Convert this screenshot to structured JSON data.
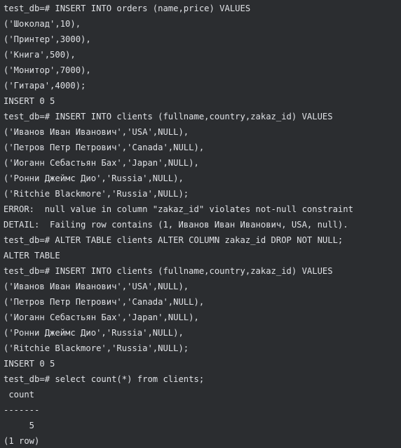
{
  "terminal": {
    "lines": [
      "test_db=# INSERT INTO orders (name,price) VALUES",
      "('Шоколад',10),",
      "('Принтер',3000),",
      "('Книга',500),",
      "('Монитор',7000),",
      "('Гитара',4000);",
      "INSERT 0 5",
      "test_db=# INSERT INTO clients (fullname,country,zakaz_id) VALUES",
      "('Иванов Иван Иванович','USA',NULL),",
      "('Петров Петр Петрович','Canada',NULL),",
      "('Иоганн Себастьян Бах','Japan',NULL),",
      "('Ронни Джеймс Дио','Russia',NULL),",
      "('Ritchie Blackmore','Russia',NULL);",
      "ERROR:  null value in column \"zakaz_id\" violates not-null constraint",
      "DETAIL:  Failing row contains (1, Иванов Иван Иванович, USA, null).",
      "test_db=# ALTER TABLE clients ALTER COLUMN zakaz_id DROP NOT NULL;",
      "ALTER TABLE",
      "test_db=# INSERT INTO clients (fullname,country,zakaz_id) VALUES",
      "('Иванов Иван Иванович','USA',NULL),",
      "('Петров Петр Петрович','Canada',NULL),",
      "('Иоганн Себастьян Бах','Japan',NULL),",
      "('Ронни Джеймс Дио','Russia',NULL),",
      "('Ritchie Blackmore','Russia',NULL);",
      "INSERT 0 5",
      "test_db=# select count(*) from clients;",
      " count",
      "-------",
      "     5",
      "(1 row)"
    ]
  },
  "colors": {
    "background": "#2b2d30",
    "text": "#dfe1e5"
  }
}
